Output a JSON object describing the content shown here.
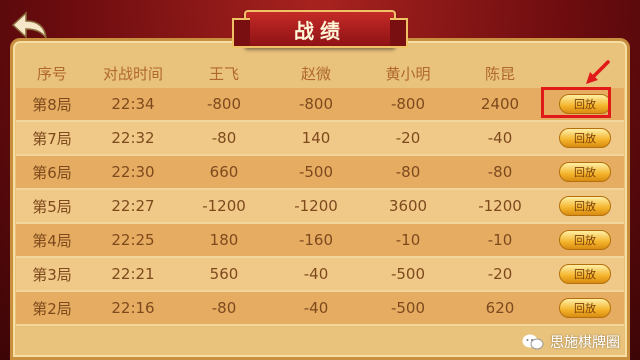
{
  "title": "战绩",
  "columns": [
    "序号",
    "对战时间",
    "王飞",
    "赵微",
    "黄小明",
    "陈昆"
  ],
  "rows": [
    {
      "round": "第8局",
      "time": "22:34",
      "scores": [
        "-800",
        "-800",
        "-800",
        "2400"
      ],
      "action": "回放"
    },
    {
      "round": "第7局",
      "time": "22:32",
      "scores": [
        "-80",
        "140",
        "-20",
        "-40"
      ],
      "action": "回放"
    },
    {
      "round": "第6局",
      "time": "22:30",
      "scores": [
        "660",
        "-500",
        "-80",
        "-80"
      ],
      "action": "回放"
    },
    {
      "round": "第5局",
      "time": "22:27",
      "scores": [
        "-1200",
        "-1200",
        "3600",
        "-1200"
      ],
      "action": "回放"
    },
    {
      "round": "第4局",
      "time": "22:25",
      "scores": [
        "180",
        "-160",
        "-10",
        "-10"
      ],
      "action": "回放"
    },
    {
      "round": "第3局",
      "time": "22:21",
      "scores": [
        "560",
        "-40",
        "-500",
        "-20"
      ],
      "action": "回放"
    },
    {
      "round": "第2局",
      "time": "22:16",
      "scores": [
        "-80",
        "-40",
        "-500",
        "620"
      ],
      "action": "回放"
    }
  ],
  "watermark": "思施棋牌圈",
  "colors": {
    "annotation": "#e11919",
    "button": "#f4b42a",
    "panel": "#e9c27c"
  },
  "icons": {
    "back": "back-arrow-icon",
    "annotation": "annotation-arrow-icon",
    "watermark": "wechat-icon"
  }
}
